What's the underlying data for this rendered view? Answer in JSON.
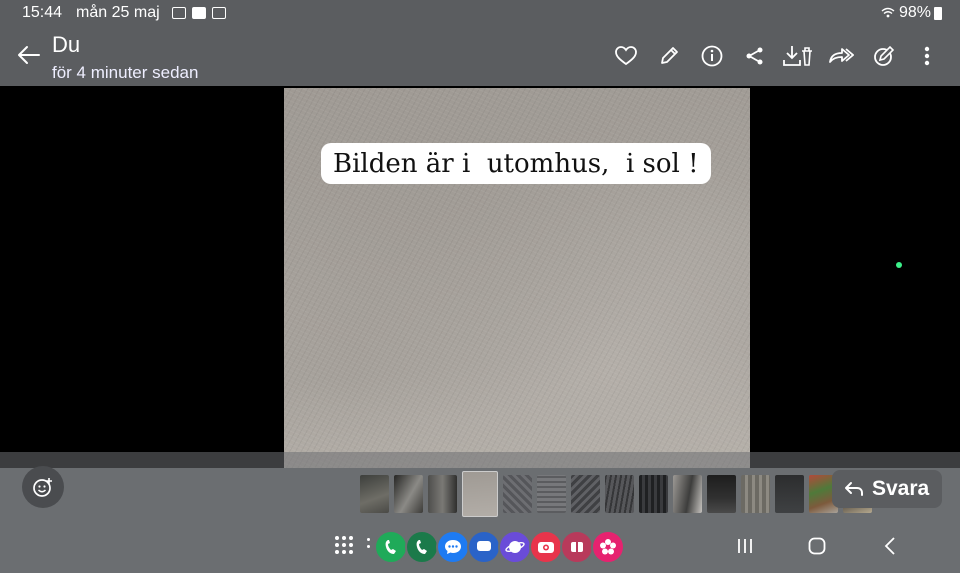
{
  "status": {
    "time": "15:44",
    "date": "mån 25 maj",
    "battery": "98%"
  },
  "header": {
    "title": "Du",
    "subtitle": "för 4 minuter sedan"
  },
  "photo": {
    "caption": "Bilden är i  utomhus,  i sol !"
  },
  "reply": {
    "label": "Svara"
  },
  "icons": {
    "back": "arrow-left-icon",
    "favorite": "heart-icon",
    "edit": "pencil-icon",
    "info": "info-icon",
    "share": "share-icon",
    "save_delete": "download-delete-icon",
    "forward": "forward-icon",
    "rotate_edit": "edit-badge-icon",
    "more": "more-vertical-icon"
  },
  "colors": {
    "bar": "#5b5d60",
    "strip": "#6b6e71"
  }
}
